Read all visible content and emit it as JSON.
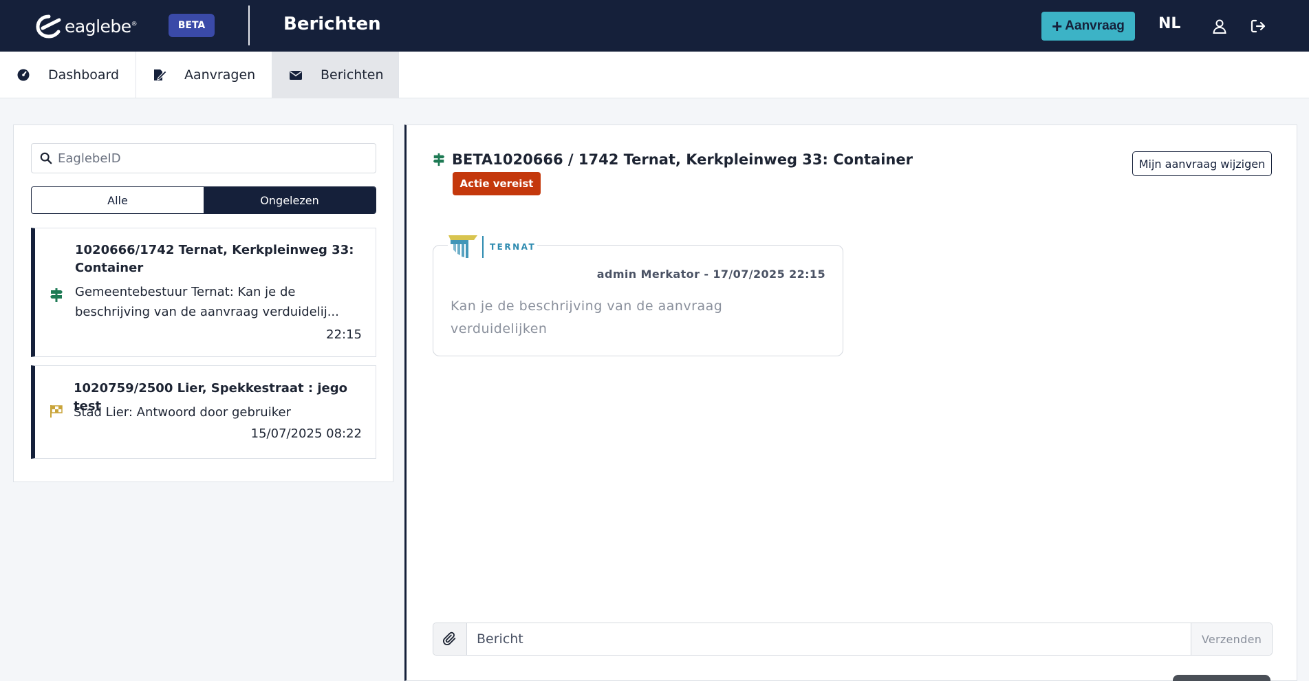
{
  "header": {
    "logo_text": "eaglebe",
    "logo_mark": "®",
    "beta_label": "BETA",
    "title": "Berichten",
    "new_request_label": "Aanvraag",
    "language": "NL",
    "icons": {
      "user": "user-icon",
      "logout": "logout-icon",
      "plus": "plus-icon"
    }
  },
  "nav": {
    "tabs": [
      {
        "label": "Dashboard",
        "icon": "dashboard-icon",
        "active": false
      },
      {
        "label": "Aanvragen",
        "icon": "edit-document-icon",
        "active": false
      },
      {
        "label": "Berichten",
        "icon": "envelope-icon",
        "active": true
      }
    ]
  },
  "sidebar": {
    "search_placeholder": "EaglebeID",
    "filter": {
      "all_label": "Alle",
      "unread_label": "Ongelezen",
      "selected": "Ongelezen"
    },
    "messages": [
      {
        "title": "1020666/1742 Ternat, Kerkpleinweg 33: Container",
        "preview": "Gemeentebestuur Ternat: Kan je de beschrijving van de aanvraag verduidelij...",
        "time": "22:15",
        "icon": "signpost-icon"
      },
      {
        "title": "1020759/2500 Lier, Spekkestraat : jego test",
        "preview": "Stad Lier: Antwoord door gebruiker",
        "time": "15/07/2025 08:22",
        "icon": "checkered-flag-icon"
      }
    ]
  },
  "conversation": {
    "title": "BETA1020666 / 1742 Ternat, Kerkpleinweg 33: Container",
    "status": "Actie vereist",
    "edit_button": "Mijn aanvraag wijzigen",
    "org_name": "TERNAT",
    "message": {
      "meta": "admin Merkator - 17/07/2025 22:15",
      "text": "Kan je de beschrijving van de aanvraag verduidelijken"
    },
    "compose": {
      "placeholder": "Bericht",
      "send_label": "Verzenden"
    }
  },
  "colors": {
    "topbar": "#15203a",
    "accent": "#3cb3c6",
    "beta": "#3a4aa8",
    "status_action": "#c4380c",
    "ternat_blue": "#2e8bb0",
    "ternat_gold": "#d8c44f",
    "signpost_green": "#1e7a54",
    "flag_gold": "#c9a43a"
  }
}
